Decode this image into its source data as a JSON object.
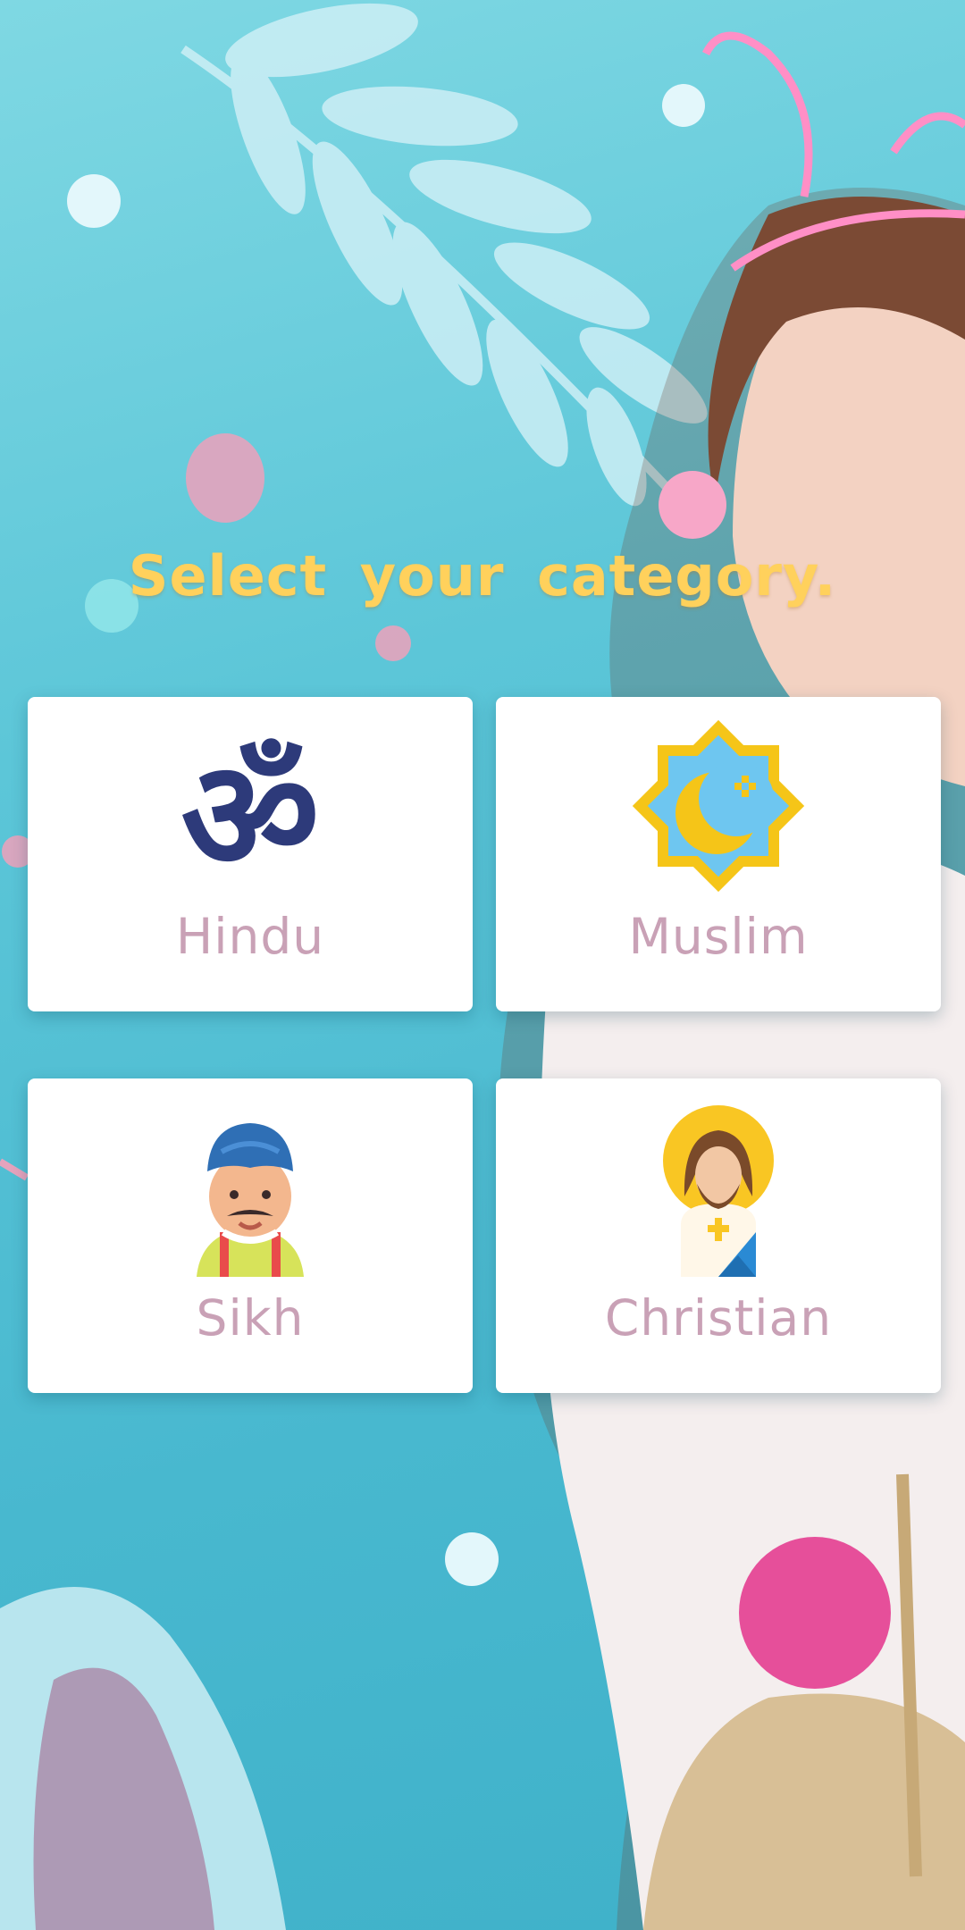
{
  "screen": {
    "title": "Select your category.",
    "background_color": "#5cc6d8",
    "title_color": "#ffd15c",
    "label_color": "#c9a1b6"
  },
  "categories": [
    {
      "label": "Hindu",
      "icon": "om-icon"
    },
    {
      "label": "Muslim",
      "icon": "crescent-star-icon"
    },
    {
      "label": "Sikh",
      "icon": "sikh-man-icon"
    },
    {
      "label": "Christian",
      "icon": "jesus-icon"
    }
  ]
}
